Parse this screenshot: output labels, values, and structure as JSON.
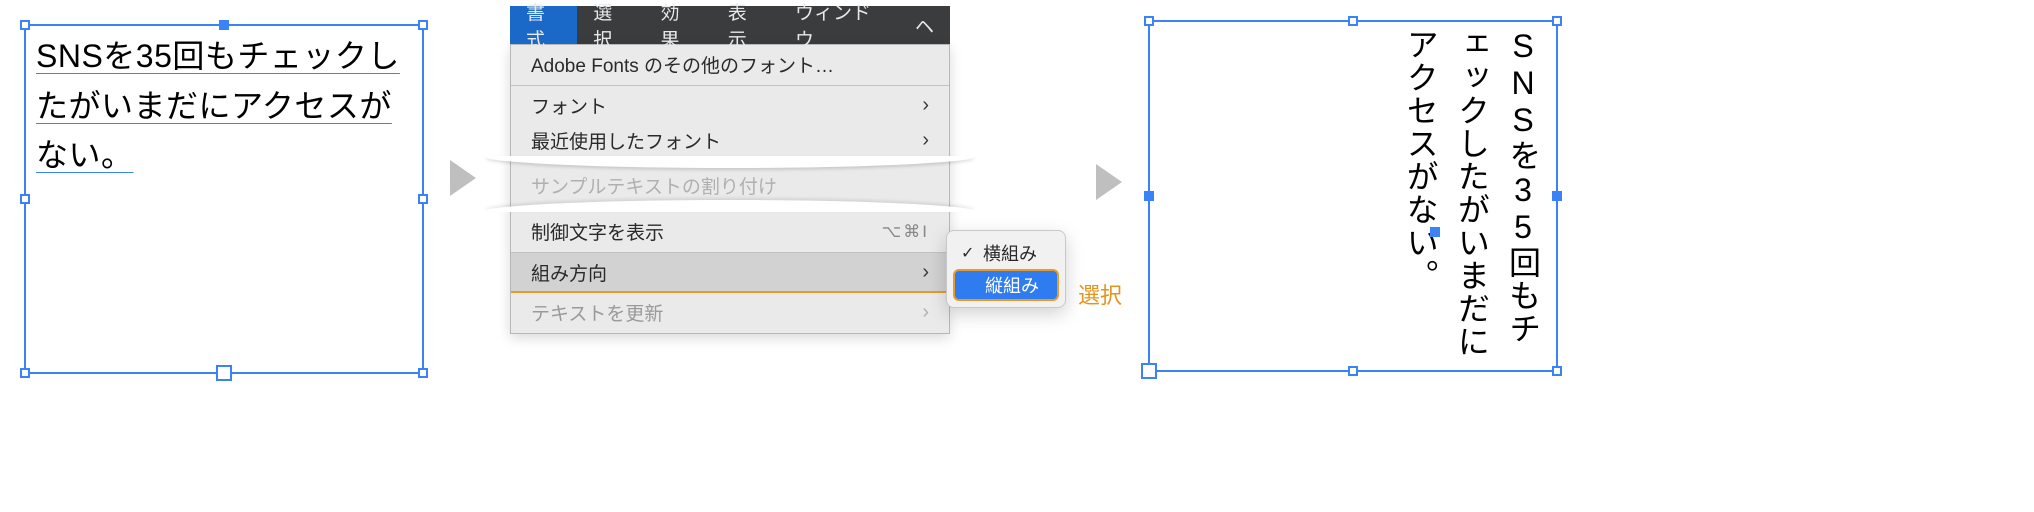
{
  "textframe": {
    "content": "SNSを35回もチェックしたがいまだにアクセスがない。"
  },
  "arrow_label": "",
  "menubar": {
    "items": [
      "書式",
      "選択",
      "効果",
      "表示",
      "ウィンドウ"
    ],
    "partial": "ヘ"
  },
  "menu": {
    "adobe_fonts": "Adobe Fonts のその他のフォント…",
    "font": "フォント",
    "recent_font": "最近使用したフォント",
    "hidden_snip": "サンプルテキストの割り付け",
    "show_hidden_chars": "制御文字を表示",
    "show_hidden_shortcut": "⌥⌘I",
    "direction": "組み方向",
    "update_text": "テキストを更新"
  },
  "submenu": {
    "horizontal": "横組み",
    "vertical": "縦組み"
  },
  "select_label": "選択"
}
